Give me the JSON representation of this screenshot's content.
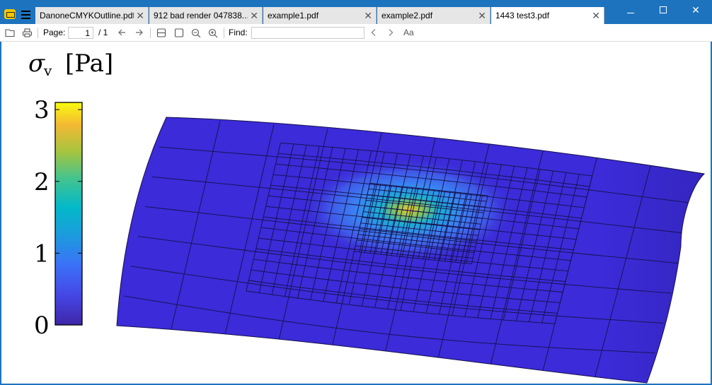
{
  "tabs": [
    {
      "label": "DanoneCMYKOutline.pdf",
      "close": "✕",
      "active": false
    },
    {
      "label": "912 bad render 047838...",
      "close": "✕",
      "active": false
    },
    {
      "label": "example1.pdf",
      "close": "✕",
      "active": false
    },
    {
      "label": "example2.pdf",
      "close": "✕",
      "active": false
    },
    {
      "label": "1443 test3.pdf",
      "close": "✕",
      "active": true
    }
  ],
  "window": {
    "minimize": "—",
    "maximize": "☐",
    "close": "✕"
  },
  "toolbar": {
    "page_label": "Page:",
    "page_value": "1",
    "page_total": "/ 1",
    "find_label": "Find:",
    "find_value": "",
    "match_case": "Aa"
  },
  "document": {
    "colorbar_title_symbol": "σ",
    "colorbar_title_subscript": "v",
    "colorbar_title_unit": "[Pa]",
    "colorbar_ticks": [
      "3",
      "2",
      "1",
      "0"
    ],
    "colorbar_tick_values": [
      3,
      2,
      1,
      0
    ],
    "colorbar_range": [
      0,
      3.1
    ],
    "colormap": "parula"
  },
  "colors": {
    "titlebar": "#1e73be",
    "surface_base": "#3b2bd8",
    "peak": "#f0c43a"
  }
}
